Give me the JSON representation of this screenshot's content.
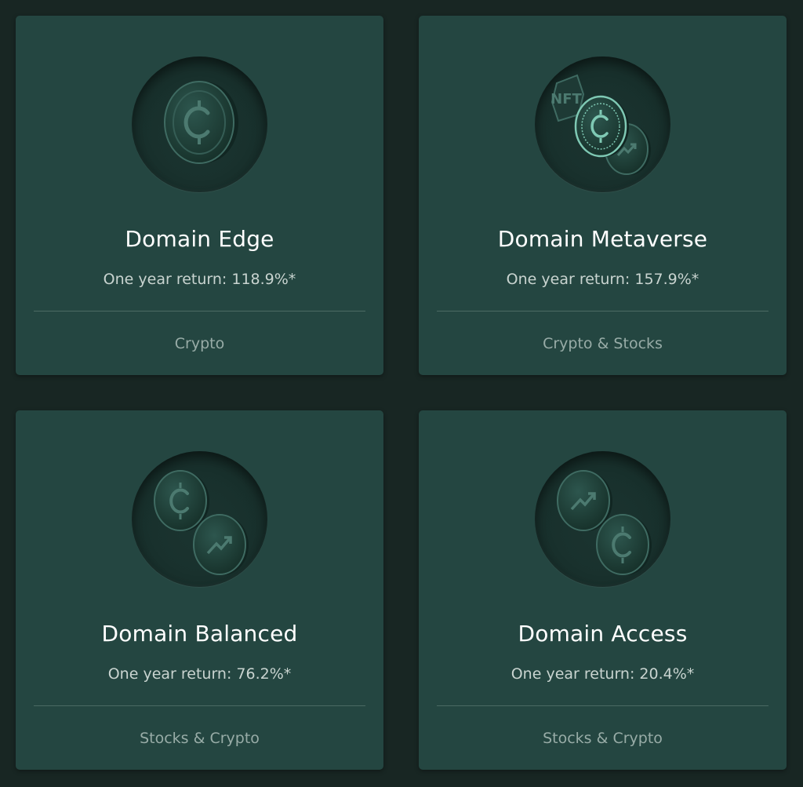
{
  "cards": [
    {
      "title": "Domain Edge",
      "return_text": "One year return: 118.9%*",
      "category": "Crypto",
      "icon": "crypto-coin-icon"
    },
    {
      "title": "Domain Metaverse",
      "return_text": "One year return: 157.9%*",
      "category": "Crypto & Stocks",
      "icon": "nft-crypto-stocks-coins-icon",
      "emblem_text": "NFT"
    },
    {
      "title": "Domain Balanced",
      "return_text": "One year return: 76.2%*",
      "category": "Stocks & Crypto",
      "icon": "crypto-stock-coins-icon"
    },
    {
      "title": "Domain Access",
      "return_text": "One year return: 20.4%*",
      "category": "Stocks & Crypto",
      "icon": "stock-crypto-coins-icon"
    }
  ],
  "colors": {
    "page_background": "#182623",
    "card_background": "#244641",
    "coin_dark": "#1e3a35",
    "coin_edge": "#3f6b62",
    "nft_highlight": "#7fc9b4"
  }
}
